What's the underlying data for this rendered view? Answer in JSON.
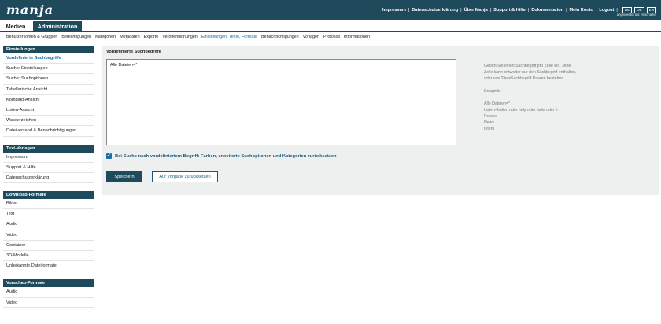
{
  "header": {
    "logo": "manja",
    "nav": [
      "Impressum",
      "Datenschutzerklärung",
      "Über Manja",
      "Support & Hilfe",
      "Dokumentation",
      "Mein Konto",
      "Logout"
    ],
    "languages": [
      "DE",
      "DE",
      "EN"
    ],
    "user_line": "angemeldet als: m.schaffer"
  },
  "main_tabs": [
    "Medien",
    "Administration"
  ],
  "subnav": [
    "Benutzerkonten & Gruppen",
    "Berechtigungen",
    "Kategorien",
    "Metadaten",
    "Exporte",
    "Veröffentlichungen",
    "Einstellungen, Texte, Formate",
    "Benachrichtigungen",
    "Vorlagen",
    "Protokoll",
    "Informationen"
  ],
  "sidebar": {
    "groups": [
      {
        "title": "Einstellungen",
        "items": [
          "Vordefinierte Suchbegriffe",
          "Suche: Einstellungen",
          "Suche: Suchoptionen",
          "Tabellarische Ansicht",
          "Kompakt-Ansicht",
          "Listen-Ansicht",
          "Wasserzeichen",
          "Dateiversand & Benachrichtigungen"
        ]
      },
      {
        "title": "Text-Vorlagen",
        "items": [
          "Impressum",
          "Support & Hilfe",
          "Datenschutzerklärung"
        ]
      },
      {
        "title": "Download-Formate",
        "items": [
          "Bilder",
          "Text",
          "Audio",
          "Video",
          "Container",
          "3D-Modelle",
          "Unbekannte Dateiformate"
        ]
      },
      {
        "title": "Vorschau-Formate",
        "items": [
          "Audio",
          "Video"
        ]
      }
    ]
  },
  "content": {
    "title": "Vordefinierte Suchbegriffe",
    "textarea_value": "Alle Dateien=*",
    "help": {
      "intro": [
        "Geben Sie einen Suchbegriff pro Zeile ein. Jede",
        "Zeile kann entweder nur den Suchbegriff enthalten,",
        "oder aus Titel=Suchbegriff Paaren bestehen."
      ],
      "example_label": "Beispiele:",
      "examples": [
        "Alle Dateien=*",
        "Italien=Italien oder Italy oder Italia oder it",
        "Presse",
        "News",
        "Intern"
      ]
    },
    "reset_checkbox_label": "Bei Suche nach vordefiniertem Begriff: Farben, erweiterte Suchoptionen und Kategorien zurücksetzen",
    "save_label": "Speichern",
    "default_label": "Auf Vorgabe zurücksetzen"
  },
  "colors": {
    "header_bg": "#1e4a5c",
    "accent": "#1a6ea0",
    "panel_bg": "#eef0f0"
  }
}
